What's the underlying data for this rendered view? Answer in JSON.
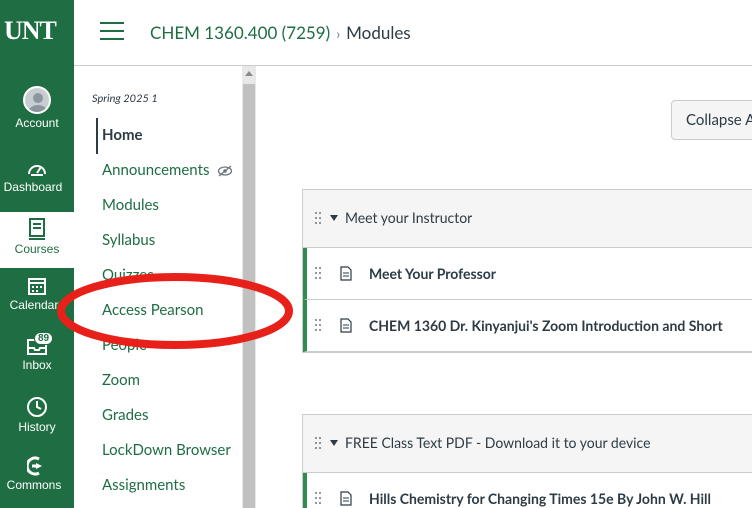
{
  "global_nav": {
    "logo": "UNT",
    "items": [
      {
        "label": "Account",
        "icon": "avatar"
      },
      {
        "label": "Dashboard",
        "icon": "dashboard-icon"
      },
      {
        "label": "Courses",
        "icon": "courses-icon"
      },
      {
        "label": "Calendar",
        "icon": "calendar-icon"
      },
      {
        "label": "Inbox",
        "icon": "inbox-icon",
        "badge": "89"
      },
      {
        "label": "History",
        "icon": "history-icon"
      },
      {
        "label": "Commons",
        "icon": "commons-icon"
      }
    ]
  },
  "header": {
    "course": "CHEM 1360.400 (7259)",
    "separator": "›",
    "current": "Modules"
  },
  "course_nav": {
    "term": "Spring 2025 1",
    "items": [
      {
        "label": "Home"
      },
      {
        "label": "Announcements"
      },
      {
        "label": "Modules"
      },
      {
        "label": "Syllabus"
      },
      {
        "label": "Quizzes"
      },
      {
        "label": "Access Pearson"
      },
      {
        "label": "People"
      },
      {
        "label": "Zoom"
      },
      {
        "label": "Grades"
      },
      {
        "label": "LockDown Browser"
      },
      {
        "label": "Assignments"
      }
    ]
  },
  "main": {
    "collapse_label": "Collapse All",
    "modules": [
      {
        "title": "Meet your Instructor",
        "items": [
          {
            "title": "Meet Your Professor"
          },
          {
            "title": "CHEM 1360 Dr. Kinyanjui's Zoom Introduction and Short"
          }
        ]
      },
      {
        "title": "FREE Class Text PDF - Download it to your device",
        "items": [
          {
            "title": "Hills Chemistry for Changing Times 15e By John W. Hill"
          }
        ]
      }
    ]
  },
  "colors": {
    "brand_green": "#1f6e43",
    "annotation_red": "#e8201a"
  }
}
